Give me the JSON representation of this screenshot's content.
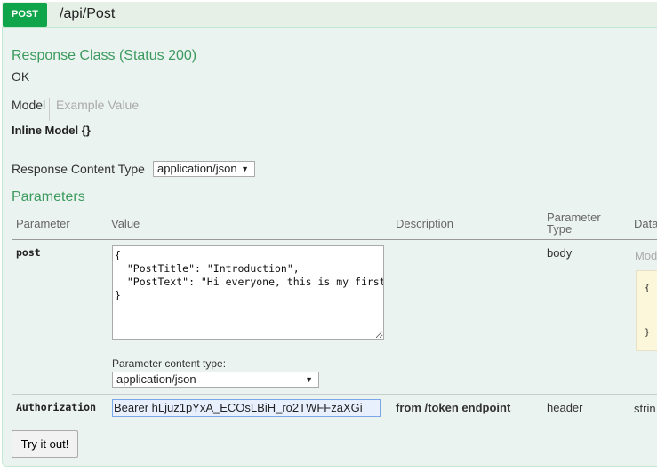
{
  "operation": {
    "method": "POST",
    "path": "/api/Post",
    "method_color": "#10a54a"
  },
  "response": {
    "title": "Response Class (Status 200)",
    "status_text": "OK",
    "tabs": [
      "Model",
      "Example Value"
    ],
    "model_name": "Inline Model {}",
    "content_type_label": "Response Content Type",
    "content_type_value": "application/json"
  },
  "parameters": {
    "title": "Parameters",
    "columns": [
      "Parameter",
      "Value",
      "Description",
      "Parameter Type",
      "Data"
    ],
    "rows": [
      {
        "name": "post",
        "value": "{\n  \"PostTitle\": \"Introduction\",\n  \"PostText\": \"Hi everyone, this is my first post. Excited to be here!\"\n}",
        "content_type_label": "Parameter content type:",
        "content_type_value": "application/json",
        "description": "",
        "param_type": "body",
        "data_label": "Mod",
        "model_open": "{",
        "model_close": "}"
      },
      {
        "name": "Authorization",
        "value": "Bearer hLjuz1pYxA_ECOsLBiH_ro2TWFFzaXGi",
        "description": "from /token endpoint",
        "param_type": "header",
        "data_type": "strin"
      }
    ]
  },
  "try_button": "Try it out!"
}
